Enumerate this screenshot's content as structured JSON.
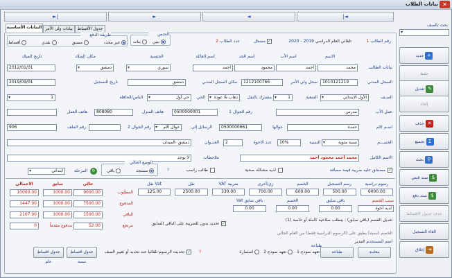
{
  "window": {
    "title": "بيانات الطلاب"
  },
  "nav": {
    "first": "|◄",
    "prev": "◄",
    "next": "►",
    "last": "►|"
  },
  "search": {
    "label": "بحث بالصف",
    "value": ""
  },
  "sidebar": [
    {
      "label": "جديد",
      "color": "#2f6fd0",
      "glyph": "+",
      "enabled": true
    },
    {
      "label": "حفظ",
      "color": "#9aa0a8",
      "glyph": "",
      "enabled": false
    },
    {
      "label": "تعديل",
      "color": "#3a8a3a",
      "glyph": "✎",
      "enabled": true
    },
    {
      "label": "إلغاء",
      "color": "#9aa0a8",
      "glyph": "",
      "enabled": false
    },
    {
      "label": "حذف",
      "color": "#c0221a",
      "glyph": "✕",
      "enabled": true
    },
    {
      "label": "تجميع",
      "color": "#2f6fd0",
      "glyph": "Σ",
      "enabled": true
    },
    {
      "label": "بحث",
      "color": "#2f6fd0",
      "glyph": "⚲",
      "enabled": true
    },
    {
      "label": "سند قبض",
      "color": "#3a8a3a",
      "glyph": "$",
      "enabled": true
    },
    {
      "label": "سند دفع",
      "color": "#3a8a3a",
      "glyph": "$",
      "enabled": true
    },
    {
      "label": "حذف جدول الاقساط",
      "color": "#9aa0a8",
      "glyph": "",
      "enabled": false
    },
    {
      "label": "الغاء التسجيل",
      "color": "#c0221a",
      "glyph": "",
      "enabled": true
    },
    {
      "label": "إغلاق",
      "color": "#b86a1a",
      "glyph": "⇥",
      "enabled": true
    }
  ],
  "tabs": [
    "البيانات الأساسية",
    "بيانات ولي الأمر",
    "جدول الأقساط"
  ],
  "basic": {
    "student_no_label": "رقم الطالب",
    "student_no": "1",
    "year_label": "تلقائي العام الدراسي",
    "year": "2019 - 2020",
    "registered_label": "مسجل",
    "count_label": "عدد الطلاب",
    "count": "2",
    "gender_label": "الجنس",
    "gender_male": "بنين",
    "gender_female": "بنات",
    "pay_label": "طريقة الدفع",
    "pay_opts": [
      "أقساط",
      "نقدي",
      "مسبق",
      "غير محدد"
    ],
    "col_name": "الاسم",
    "col_father": "اسم الأب",
    "col_grand": "اسم الجد",
    "col_family": "اسم العائلة",
    "col_nat": "الجنسية",
    "col_birthplace": "مكان الميلاد",
    "col_birthdate": "تاريخ الميلاد",
    "row_label": "بيانات الطالب",
    "name": "محمد",
    "father": "أحمد",
    "grand": "محمود",
    "family": "أحمد",
    "nat": "سوري",
    "birthplace": "دمشق",
    "birthdate": "2012/01/01",
    "civil_label": "السجل المدني",
    "civil": "1010121219",
    "guardian_civil_label": "سجل ولي الأمر",
    "guardian_civil": "1212100766",
    "civil_place_label": "مكان السجل المدني",
    "civil_place": "دمشق",
    "reg_date_label": "تاريخ التسجيل",
    "reg_date": "2019/09/01",
    "class_label": "الصـف",
    "class": "الأول الابتدائي",
    "section_label": "الشعبة",
    "section": "1",
    "transport_label": "مشترك بالنقل",
    "transport": "ذهاب & عودة",
    "district_label": "الحي",
    "district": "حي أول",
    "city_label": "الباص/الحافلة",
    "city": "1",
    "job_label": "عمل الأب",
    "job": "مدرس",
    "mobile_label": "رقم الجوال 1",
    "mobile": "0500000001",
    "phone_label": "هاتف المنزل",
    "phone": "808080",
    "work_phone_label": "هاتف العمل",
    "work_phone": "",
    "mother_label": "اسـم الام",
    "mother": "حمدة",
    "mother_mobile_label": "جوالها",
    "mother_mobile": "0500000661",
    "msgs_label": "الرسائل إلى",
    "msgs": "جوال الام",
    "mobile2_label": "رقم الجوال 2",
    "mobile2": "",
    "file_label": "رقم الملف",
    "file": "906",
    "discount_label": "الخصـــم",
    "discount": "نسبة مئوية",
    "pct_label": "النسبة",
    "pct": "10%",
    "siblings_label": "عدد الاخوة",
    "siblings": "2",
    "address_label": "العنــوان",
    "address": "دمشق -الميدان",
    "notes_label": "ملاحظات",
    "notes": "لا يوجد",
    "full_name_label": "الاسم الكامل",
    "full_name": "محمد أحمد محمود أحمد",
    "vat_label": "مستحق عليه ضريبة قيمة مضافة",
    "health_label": "لديه مشكلة صحية",
    "fail_label": "طالب راسب",
    "status_label": "الوضع الحالي",
    "status_cur": "مستجد",
    "status_rem": "باقي",
    "stage_label": "المرحلة",
    "stage": "ابتدائي"
  },
  "fees": {
    "headers": [
      "رسوم دراسية",
      "رسم التسجيل",
      "الخصم",
      "زي/أخرى",
      "ضريبة VAT",
      "نقل",
      "Vat نقل"
    ],
    "values": [
      "6000.00",
      "500.00",
      "600.00",
      "700.00",
      "330.00",
      "2500.00",
      "125.00"
    ],
    "after_disc_label": "سبب الخصم",
    "his_bros": "لديه أخوة",
    "sub_headers": [
      "باقي سابق",
      "الخصم",
      "باقي سابق Vat"
    ],
    "sub_values": [
      "0.00",
      "0.00",
      "0.00"
    ],
    "col_current": "حالي",
    "col_prev": "سابق",
    "col_total": "الاجمالي",
    "rows": [
      {
        "label": "المطلوب",
        "current": "9000.00",
        "prev": "1000.00",
        "total": "10000.00"
      },
      {
        "label": "المدفوع",
        "current": "7500.00",
        "prev": "1000.00",
        "total": "1447.00"
      },
      {
        "label": "الباقي",
        "current": "1500.00",
        "prev": "1000.00",
        "total": "2107.00"
      },
      {
        "label": "مرتجع",
        "current": "52.00",
        "prev": "مدفوع مقدماً",
        "total": "0"
      }
    ],
    "note1": "تعديل القسم (باقي سابق) : يتطلب صلاحية كاملة أو خاصة (1)",
    "vat_prev_label": "تحديد بدون للضريبة على الباقي السابق",
    "note2": "الخصم (نسبة) يطبق على (الرسوم الدراسية فقط) من العام الحالي",
    "user_label": "اسم المستخدم",
    "user": "المدير"
  },
  "bottom": {
    "print_group": "طباعة",
    "print_opts": [
      "تعهد نموذج 1",
      "تعهد نموذج 2",
      "استمارة"
    ],
    "print_btn": "طباعة",
    "preview_btn": "معاينة",
    "update_note": "تحديث الرسوم تلقائيا عند تحديد أو تغيير الصف",
    "btn_pct": "جدول اقساط نسبة",
    "btn_gen": "جدول اقساط عام"
  }
}
